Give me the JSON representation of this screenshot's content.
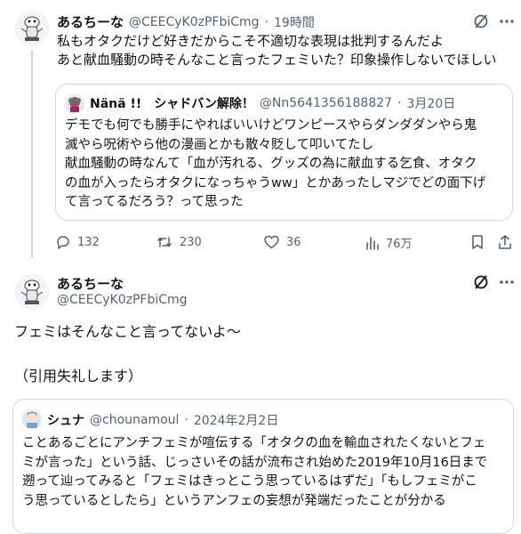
{
  "tweet1": {
    "author_name": "あるちーな",
    "handle": "@CEECyK0zPFbiCmg",
    "time": "19時間",
    "lines": [
      "私もオタクだけど好きだからこそ不適切な表現は批判するんだよ",
      "あと献血騒動の時そんなこと言ったフェミいた？印象操作しないでほしい"
    ],
    "quote": {
      "author_name": "Nänä !!　シャドバン解除！",
      "handle": "@Nn5641356188827",
      "date": "3月20日",
      "lines": [
        "デモでも何でも勝手にやればいいけどワンピースやらダンダダンやら鬼",
        "滅やら呪術やら他の漫画とかも散々貶して叩いてたし",
        "献血騒動の時なんて「血が汚れる、グッズの為に献血する乞食、オタク",
        "の血が入ったらオタクになっちゃうww」とかあったしマジでどの面下げ",
        "て言ってるだろう？って思った"
      ]
    },
    "actions": {
      "replies": "132",
      "retweets": "230",
      "likes": "36",
      "views": "76万"
    }
  },
  "tweet2": {
    "author_name": "あるちーな",
    "handle": "@CEECyK0zPFbiCmg",
    "line1": "フェミはそんなこと言ってないよ〜",
    "line2": "（引用失礼します）",
    "quote": {
      "author_name": "シュナ",
      "handle": "@chounamoul",
      "date": "2024年2月2日",
      "lines": [
        "ことあるごとにアンチフェミが喧伝する「オタクの血を輸血されたくないとフェ",
        "ミが言った」という話、じっさいその話が流布され始めた2019年10月16日まで",
        "遡って辿ってみると「フェミはきっとこう思っているはずだ」「もしフェミがこ",
        "う思っているとしたら」というアンフェの妄想が発端だったことが分かる"
      ]
    }
  },
  "colors": {
    "text": "#0f1419",
    "muted": "#536471",
    "border": "#cfd9de"
  }
}
